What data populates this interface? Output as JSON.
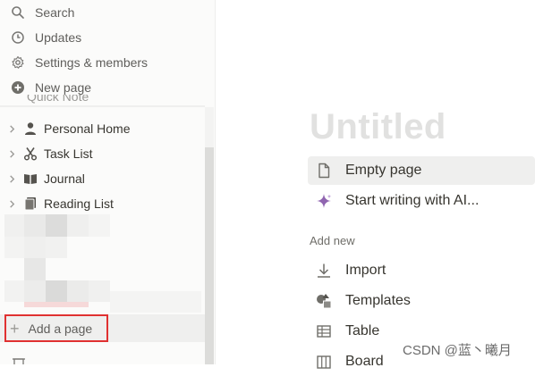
{
  "sidebar": {
    "menu": [
      {
        "label": "Search",
        "icon": "search-icon"
      },
      {
        "label": "Updates",
        "icon": "clock-icon"
      },
      {
        "label": "Settings & members",
        "icon": "gear-icon"
      },
      {
        "label": "New page",
        "icon": "plus-circle-icon"
      }
    ],
    "quick_note": "Quick Note",
    "pages": [
      {
        "label": "Personal Home",
        "icon": "person-icon"
      },
      {
        "label": "Task List",
        "icon": "scissors-icon"
      },
      {
        "label": "Journal",
        "icon": "book-icon"
      },
      {
        "label": "Reading List",
        "icon": "books-icon"
      }
    ],
    "add_page_label": "Add a page"
  },
  "main": {
    "title": "Untitled",
    "options": [
      {
        "label": "Empty page",
        "icon": "document-icon",
        "selected": true
      },
      {
        "label": "Start writing with AI...",
        "icon": "sparkle-icon",
        "selected": false
      }
    ],
    "add_new_label": "Add new",
    "add_new_items": [
      {
        "label": "Import",
        "icon": "download-icon"
      },
      {
        "label": "Templates",
        "icon": "shapes-icon"
      },
      {
        "label": "Table",
        "icon": "table-icon"
      },
      {
        "label": "Board",
        "icon": "board-icon"
      }
    ]
  },
  "watermark": "CSDN @蓝丶曦月",
  "colors": {
    "sidebar_bg": "#fbfbfa",
    "highlight_border": "#e03131",
    "title_placeholder": "#e1e1e0",
    "ai_sparkle": "#9065b0"
  }
}
